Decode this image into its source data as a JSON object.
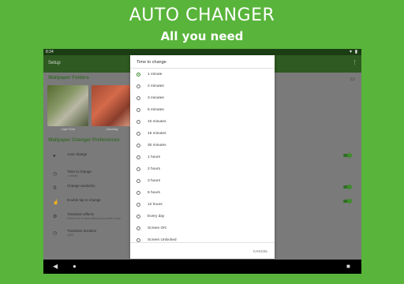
{
  "promo": {
    "title": "AUTO CHANGER",
    "subtitle": "All you need"
  },
  "statusbar": {
    "time": "8:34",
    "icons": "▾ ▮"
  },
  "appbar": {
    "title": "Setup",
    "menu": "⋮"
  },
  "main": {
    "folders_heading": "Wallpaper Folders",
    "folder_icon": "▭",
    "thumbnails": [
      {
        "label": "Cape Point"
      },
      {
        "label": "Gameday"
      }
    ],
    "prefs_heading": "Wallpaper Changer Preferences",
    "preferences": [
      {
        "title": "Auto change",
        "subtitle": "",
        "icon": "●",
        "toggle_on": true
      },
      {
        "title": "Time to change",
        "subtitle": "1 minute",
        "icon": "◷",
        "toggle_on": false
      },
      {
        "title": "Change randomly",
        "subtitle": "",
        "icon": "⇅",
        "toggle_on": true
      },
      {
        "title": "Double tap to change",
        "subtitle": "",
        "icon": "☝",
        "toggle_on": true
      },
      {
        "title": "Transition effects",
        "subtitle": "Select one or more effects you prefer to use",
        "icon": "⚙",
        "toggle_on": false
      },
      {
        "title": "Transition duration",
        "subtitle": "1500",
        "icon": "◷",
        "toggle_on": false
      }
    ]
  },
  "dialog": {
    "title": "Time to change",
    "selected_index": 0,
    "options": [
      "1 minute",
      "2 minutes",
      "3 minutes",
      "5 minutes",
      "10 minutes",
      "15 minutes",
      "30 minutes",
      "1 hours",
      "2 hours",
      "3 hours",
      "6 hours",
      "12 hours",
      "Every day",
      "Screen ON",
      "Screen Unlocked"
    ],
    "cancel_label": "CANCEL"
  },
  "navbar": {
    "back": "◀",
    "home": "●",
    "recents": "■"
  }
}
